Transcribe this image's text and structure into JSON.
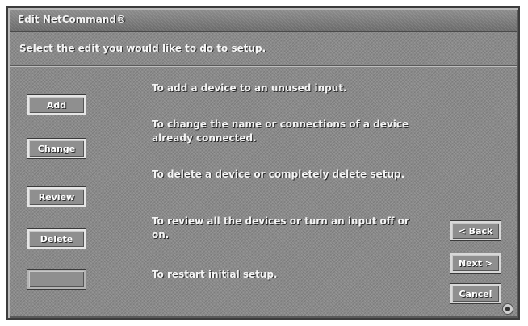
{
  "window": {
    "title": "Edit NetCommand®"
  },
  "instruction": "Select the edit you would like to do to setup.",
  "options": [
    {
      "button": "Add",
      "description": "To add a device to an unused input."
    },
    {
      "button": "Change",
      "description": "To change the name or connections of a device already connected."
    },
    {
      "button": "Review",
      "description": "To delete a device or completely delete setup."
    },
    {
      "button": "Delete",
      "description": "To review all the devices or turn an input off or on."
    },
    {
      "button": "",
      "description": "To restart initial setup."
    }
  ],
  "nav": {
    "back": "< Back",
    "next": "Next >",
    "cancel": "Cancel"
  },
  "corner_icon": "globe-icon"
}
